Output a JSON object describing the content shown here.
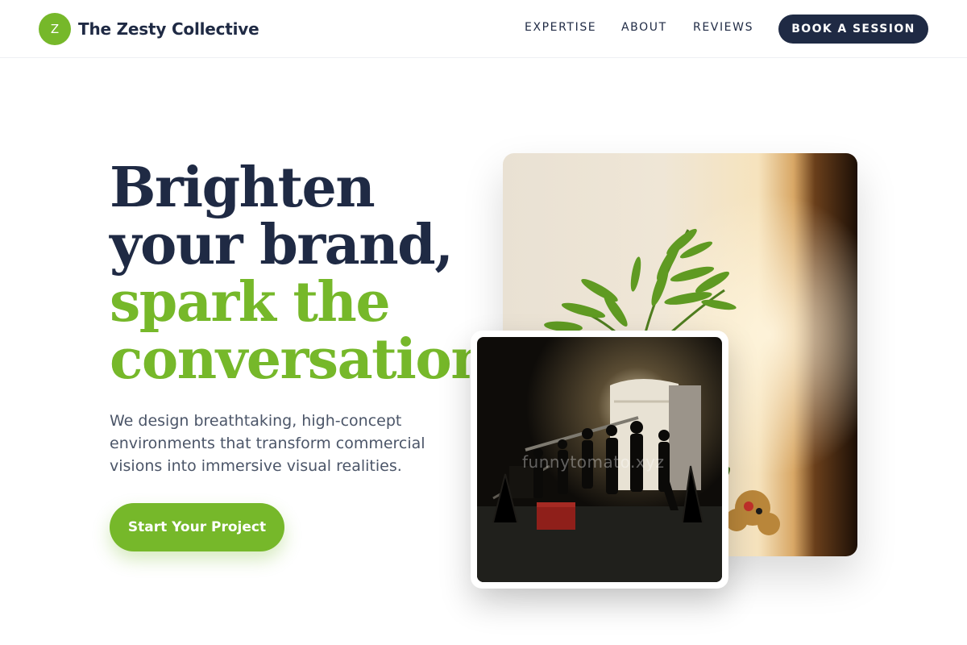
{
  "header": {
    "logo_letter": "Z",
    "brand_name": "The Zesty Collective",
    "nav": [
      "EXPERTISE",
      "ABOUT",
      "REVIEWS"
    ],
    "book_label": "BOOK A SESSION"
  },
  "hero": {
    "headline_lines": [
      "Brighten",
      "your brand,",
      "spark the",
      "conversation."
    ],
    "subtext": "We design breathtaking, high-concept environments that transform commercial visions into immersive visual realities.",
    "cta_label": "Start Your Project"
  },
  "images": {
    "back_photo": "plant-in-sunlit-room",
    "front_photo": "night-film-crew-on-set",
    "watermark": "funnytomato.xyz"
  },
  "colors": {
    "accent_green": "#76b82a",
    "navy": "#1f2a44",
    "body_gray": "#4b5568"
  }
}
